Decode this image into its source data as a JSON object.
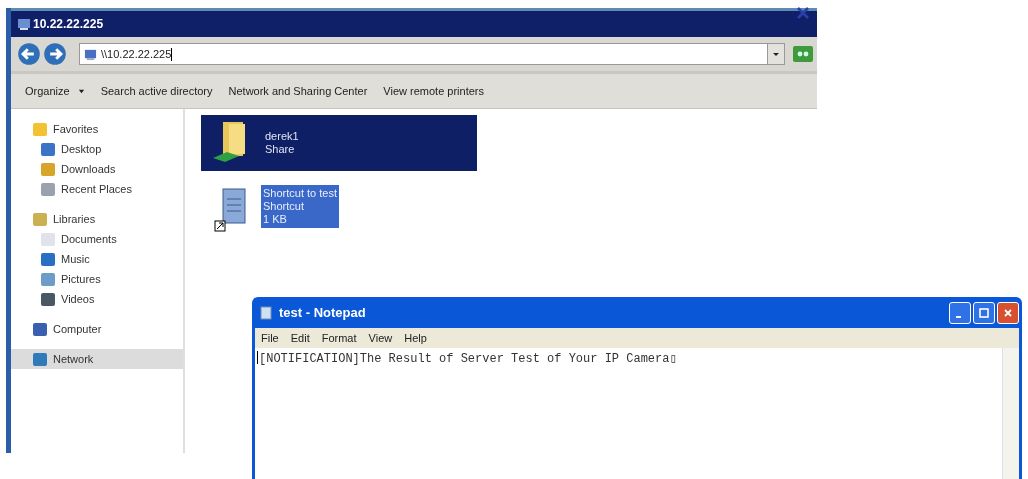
{
  "explorer": {
    "title": "10.22.22.225",
    "address": "\\\\10.22.22.225",
    "toolbar": [
      {
        "label": "Organize",
        "dropdown": true
      },
      {
        "label": "Search active directory",
        "dropdown": false
      },
      {
        "label": "Network and Sharing Center",
        "dropdown": false
      },
      {
        "label": "View remote printers",
        "dropdown": false
      }
    ],
    "sidebar": [
      {
        "label": "Favorites",
        "selected": false,
        "children": [
          {
            "label": "Desktop",
            "selected": false
          },
          {
            "label": "Downloads",
            "selected": false
          },
          {
            "label": "Recent Places",
            "selected": false
          }
        ]
      },
      {
        "label": "Libraries",
        "selected": false,
        "children": [
          {
            "label": "Documents",
            "selected": false
          },
          {
            "label": "Music",
            "selected": false
          },
          {
            "label": "Pictures",
            "selected": false
          },
          {
            "label": "Videos",
            "selected": false
          }
        ]
      },
      {
        "label": "Computer",
        "selected": false
      },
      {
        "label": "Network",
        "selected": true
      }
    ],
    "files": [
      {
        "kind": "share",
        "name": "derek1",
        "type": "Share",
        "selected": true
      },
      {
        "kind": "shortcut",
        "name": "Shortcut to test",
        "type": "Shortcut",
        "size": "1 KB",
        "selected": true
      }
    ]
  },
  "notepad": {
    "title": "test - Notepad",
    "menu": [
      "File",
      "Edit",
      "Format",
      "View",
      "Help"
    ],
    "text": "[NOTIFICATION]The Result of Server Test of Your IP Camera▯"
  }
}
